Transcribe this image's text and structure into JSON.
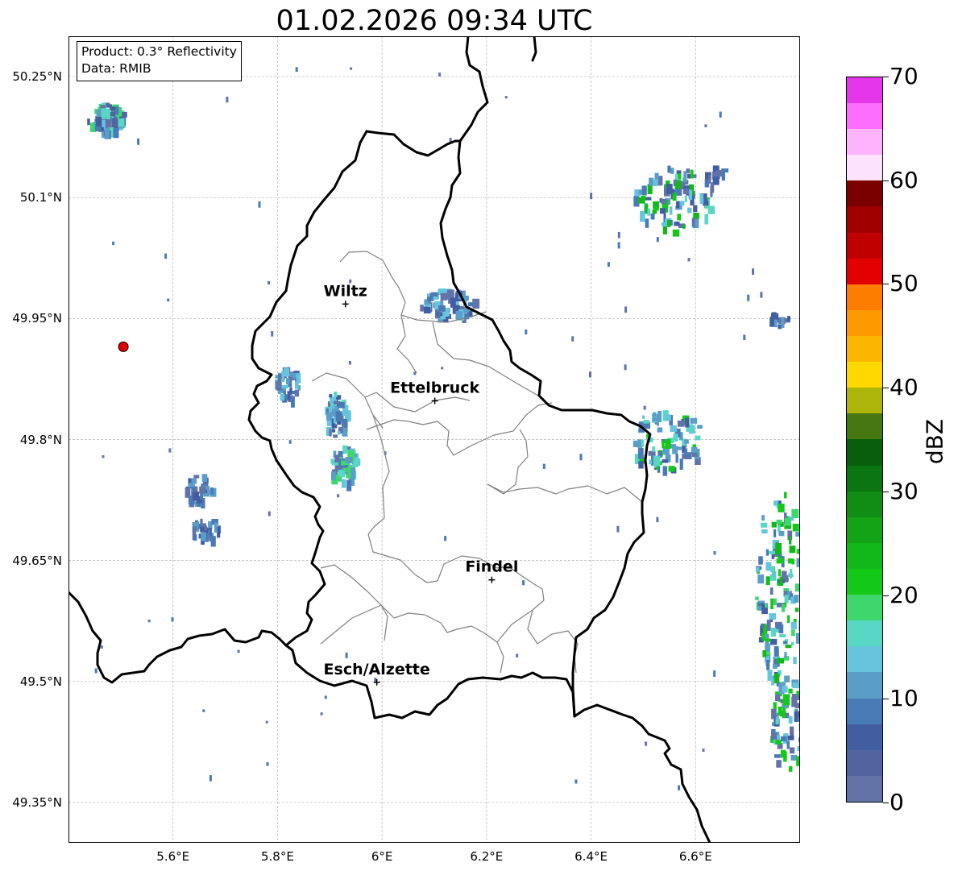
{
  "title": "01.02.2026 09:34 UTC",
  "info": {
    "product": "Product: 0.3° Reflectivity",
    "data": "Data: RMIB"
  },
  "map": {
    "lon_range": [
      5.4,
      6.8
    ],
    "lat_range": [
      49.3,
      50.3
    ],
    "lat_ticks": [
      {
        "value": 50.25,
        "label": "50.25°N"
      },
      {
        "value": 50.1,
        "label": "50.1°N"
      },
      {
        "value": 49.95,
        "label": "49.95°N"
      },
      {
        "value": 49.8,
        "label": "49.8°N"
      },
      {
        "value": 49.65,
        "label": "49.65°N"
      },
      {
        "value": 49.5,
        "label": "49.5°N"
      },
      {
        "value": 49.35,
        "label": "49.35°N"
      }
    ],
    "lon_ticks": [
      {
        "value": 5.6,
        "label": "5.6°E"
      },
      {
        "value": 5.8,
        "label": "5.8°E"
      },
      {
        "value": 6.0,
        "label": "6°E"
      },
      {
        "value": 6.2,
        "label": "6.2°E"
      },
      {
        "value": 6.4,
        "label": "6.4°E"
      },
      {
        "value": 6.6,
        "label": "6.6°E"
      }
    ],
    "grid": true,
    "cities": [
      {
        "name": "Wiltz",
        "lon": 5.93,
        "lat": 49.968
      },
      {
        "name": "Ettelbruck",
        "lon": 6.101,
        "lat": 49.848
      },
      {
        "name": "Findel",
        "lon": 6.21,
        "lat": 49.626
      },
      {
        "name": "Esch/Alzette",
        "lon": 5.99,
        "lat": 49.499
      }
    ],
    "radar_site": {
      "lon": 5.505,
      "lat": 49.915,
      "color": "#e00000"
    }
  },
  "colorbar": {
    "unit": "dBZ",
    "min": 0,
    "max": 70,
    "ticks": [
      {
        "value": 0,
        "label": "0"
      },
      {
        "value": 10,
        "label": "10"
      },
      {
        "value": 20,
        "label": "20"
      },
      {
        "value": 30,
        "label": "30"
      },
      {
        "value": 40,
        "label": "40"
      },
      {
        "value": 50,
        "label": "50"
      },
      {
        "value": 60,
        "label": "60"
      },
      {
        "value": 70,
        "label": "70"
      }
    ],
    "colors": [
      "#6273a8",
      "#52649f",
      "#425ea1",
      "#4a7ab5",
      "#5a9ec8",
      "#66c4dc",
      "#5ad6c4",
      "#3ed76e",
      "#14c818",
      "#12b81a",
      "#14a216",
      "#118c14",
      "#0b7512",
      "#085e0c",
      "#477712",
      "#adb50a",
      "#fed800",
      "#fdb600",
      "#fd9a00",
      "#fd7d00",
      "#e20000",
      "#c00000",
      "#a00000",
      "#7a0000",
      "#fde2fd",
      "#fdb4fd",
      "#fd6dfd",
      "#e536eb"
    ]
  }
}
